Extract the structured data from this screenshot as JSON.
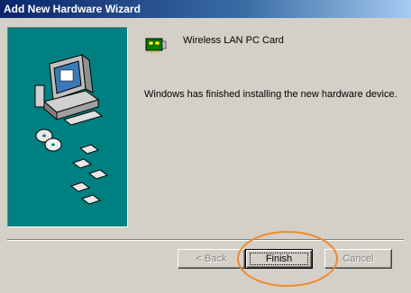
{
  "window": {
    "title": "Add New Hardware Wizard"
  },
  "device": {
    "icon": "network-card-icon",
    "name": "Wireless LAN PC Card"
  },
  "message": "Windows has finished installing the new hardware device.",
  "buttons": {
    "back_label": "< Back",
    "finish_label": "Finish",
    "cancel_label": "Cancel"
  },
  "colors": {
    "titlebar": "#0a246a",
    "panel": "#008080",
    "face": "#d4d0c8",
    "highlight_circle": "#f08a2c"
  }
}
